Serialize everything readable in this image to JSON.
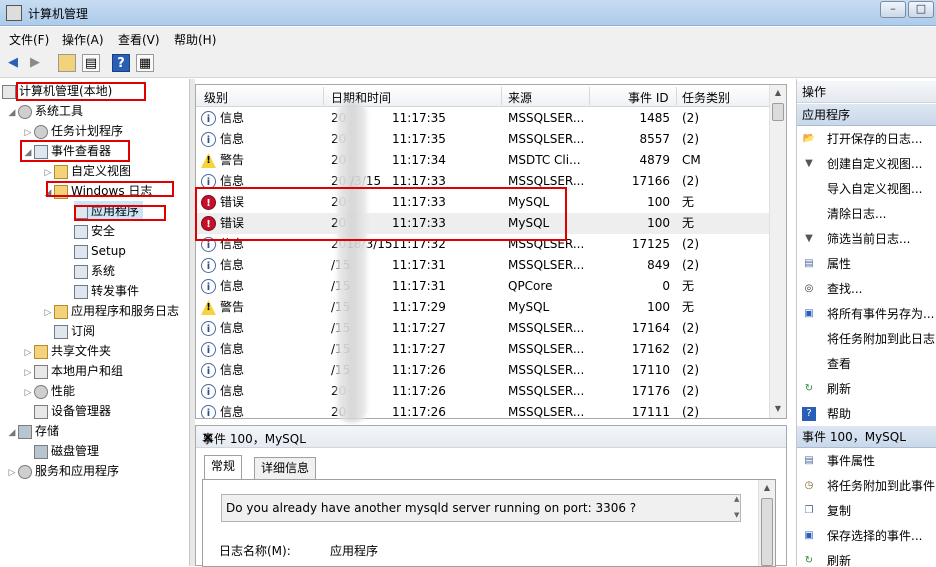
{
  "window": {
    "title": "计算机管理"
  },
  "menu": [
    "文件(F)",
    "操作(A)",
    "查看(V)",
    "帮助(H)"
  ],
  "tree": [
    {
      "label": "计算机管理(本地)",
      "level": 0,
      "arrow": "",
      "icon": "computer-icon"
    },
    {
      "label": "系统工具",
      "level": 1,
      "arrow": "◢",
      "icon": "tools-icon"
    },
    {
      "label": "任务计划程序",
      "level": 2,
      "arrow": "▷",
      "icon": "clock-icon"
    },
    {
      "label": "事件查看器",
      "level": 1,
      "arrow": "◢",
      "icon": "event-viewer-icon"
    },
    {
      "label": "自定义视图",
      "level": 2,
      "arrow": "▷",
      "icon": "folder-icon"
    },
    {
      "label": "Windows 日志",
      "level": 2,
      "arrow": "◢",
      "icon": "folder-icon"
    },
    {
      "label": "应用程序",
      "level": 3,
      "arrow": "",
      "icon": "log-icon"
    },
    {
      "label": "安全",
      "level": 3,
      "arrow": "",
      "icon": "log-icon"
    },
    {
      "label": "Setup",
      "level": 3,
      "arrow": "",
      "icon": "log-icon"
    },
    {
      "label": "系统",
      "level": 3,
      "arrow": "",
      "icon": "log-icon"
    },
    {
      "label": "转发事件",
      "level": 3,
      "arrow": "",
      "icon": "log-icon"
    },
    {
      "label": "应用程序和服务日志",
      "level": 2,
      "arrow": "▷",
      "icon": "folder-icon"
    },
    {
      "label": "订阅",
      "level": 2,
      "arrow": "",
      "icon": "subscription-icon"
    },
    {
      "label": "共享文件夹",
      "level": 1,
      "arrow": "▷",
      "icon": "shared-folder-icon"
    },
    {
      "label": "本地用户和组",
      "level": 1,
      "arrow": "▷",
      "icon": "users-icon"
    },
    {
      "label": "性能",
      "level": 1,
      "arrow": "▷",
      "icon": "performance-icon"
    },
    {
      "label": "设备管理器",
      "level": 1,
      "arrow": "",
      "icon": "device-manager-icon"
    },
    {
      "label": "存储",
      "level": 0,
      "arrow": "◢",
      "icon": "storage-icon"
    },
    {
      "label": "磁盘管理",
      "level": 1,
      "arrow": "",
      "icon": "disk-icon"
    },
    {
      "label": "服务和应用程序",
      "level": 0,
      "arrow": "▷",
      "icon": "services-icon"
    }
  ],
  "columns": {
    "level": "级别",
    "date": "日期和时间",
    "source": "来源",
    "event_id": "事件 ID",
    "task": "任务类别"
  },
  "events": [
    {
      "type": "info",
      "level": "信息",
      "date": "20",
      "time": "11:17:35",
      "source": "MSSQLSER...",
      "id": "1485",
      "task": "(2)"
    },
    {
      "type": "info",
      "level": "信息",
      "date": "20",
      "time": "11:17:35",
      "source": "MSSQLSER...",
      "id": "8557",
      "task": "(2)"
    },
    {
      "type": "warn",
      "level": "警告",
      "date": "20",
      "time": "11:17:34",
      "source": "MSDTC Cli...",
      "id": "4879",
      "task": "CM"
    },
    {
      "type": "info",
      "level": "信息",
      "date": "20 /3/15",
      "time": "11:17:33",
      "source": "MSSQLSER...",
      "id": "17166",
      "task": "(2)"
    },
    {
      "type": "error",
      "level": "错误",
      "date": "20",
      "time": "11:17:33",
      "source": "MySQL",
      "id": "100",
      "task": "无"
    },
    {
      "type": "error",
      "level": "错误",
      "date": "20",
      "time": "11:17:33",
      "source": "MySQL",
      "id": "100",
      "task": "无"
    },
    {
      "type": "info",
      "level": "信息",
      "date": "2018/3/15",
      "time": "11:17:32",
      "source": "MSSQLSER...",
      "id": "17125",
      "task": "(2)"
    },
    {
      "type": "info",
      "level": "信息",
      "date": "/15",
      "time": "11:17:31",
      "source": "MSSQLSER...",
      "id": "849",
      "task": "(2)"
    },
    {
      "type": "info",
      "level": "信息",
      "date": "/15",
      "time": "11:17:31",
      "source": "QPCore",
      "id": "0",
      "task": "无"
    },
    {
      "type": "warn",
      "level": "警告",
      "date": "/15",
      "time": "11:17:29",
      "source": "MySQL",
      "id": "100",
      "task": "无"
    },
    {
      "type": "info",
      "level": "信息",
      "date": "/15",
      "time": "11:17:27",
      "source": "MSSQLSER...",
      "id": "17164",
      "task": "(2)"
    },
    {
      "type": "info",
      "level": "信息",
      "date": "/15",
      "time": "11:17:27",
      "source": "MSSQLSER...",
      "id": "17162",
      "task": "(2)"
    },
    {
      "type": "info",
      "level": "信息",
      "date": "/15",
      "time": "11:17:26",
      "source": "MSSQLSER...",
      "id": "17110",
      "task": "(2)"
    },
    {
      "type": "info",
      "level": "信息",
      "date": "20",
      "time": "11:17:26",
      "source": "MSSQLSER...",
      "id": "17176",
      "task": "(2)"
    },
    {
      "type": "info",
      "level": "信息",
      "date": "20",
      "time": "11:17:26",
      "source": "MSSQLSER...",
      "id": "17111",
      "task": "(2)"
    }
  ],
  "detail": {
    "title": "事件 100，MySQL",
    "close": "×",
    "tabs": [
      "常规",
      "详细信息"
    ],
    "message": "Do you already have another mysqld server running on port: 3306 ?",
    "log_name_label": "日志名称(M):",
    "log_name_value": "应用程序"
  },
  "actions": {
    "header": "操作",
    "section1": "应用程序",
    "items1": [
      {
        "label": "打开保存的日志...",
        "icon": "open-folder-icon"
      },
      {
        "label": "创建自定义视图...",
        "icon": "filter-icon"
      },
      {
        "label": "导入自定义视图...",
        "icon": ""
      },
      {
        "label": "清除日志...",
        "icon": ""
      },
      {
        "label": "筛选当前日志...",
        "icon": "filter-icon"
      },
      {
        "label": "属性",
        "icon": "properties-icon"
      },
      {
        "label": "查找...",
        "icon": "binoculars-icon"
      },
      {
        "label": "将所有事件另存为...",
        "icon": "save-icon"
      },
      {
        "label": "将任务附加到此日志...",
        "icon": ""
      },
      {
        "label": "查看",
        "icon": ""
      },
      {
        "label": "刷新",
        "icon": "refresh-icon"
      },
      {
        "label": "帮助",
        "icon": "help-icon"
      }
    ],
    "section2": "事件 100，MySQL",
    "items2": [
      {
        "label": "事件属性",
        "icon": "properties-icon"
      },
      {
        "label": "将任务附加到此事件...",
        "icon": "task-icon"
      },
      {
        "label": "复制",
        "icon": "copy-icon"
      },
      {
        "label": "保存选择的事件...",
        "icon": "save-icon"
      },
      {
        "label": "刷新",
        "icon": "refresh-icon"
      }
    ]
  }
}
